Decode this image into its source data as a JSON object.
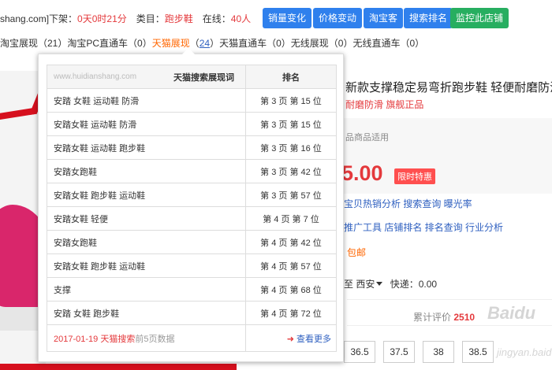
{
  "topbar": {
    "shop_domain": "shang.com",
    "downframe_label": "]下架：",
    "downframe_value": "0天0时21分",
    "category_label": "类目：",
    "category_value": "跑步鞋",
    "online_label": "在线：",
    "online_value": "40人",
    "buttons": [
      "销量变化",
      "价格变动",
      "淘宝客",
      "搜索排名",
      "监控此店铺"
    ]
  },
  "subbar": {
    "text1": "淘宝展现（21）淘宝PC直通车（0）",
    "tmall_show": "天猫展现",
    "tmall_count": "24",
    "text2": "天猫直通车（0）无线展现（0）无线直通车（0）"
  },
  "popup": {
    "watermark": "www.huidianshang.com",
    "col_keyword": "天猫搜索展现词",
    "col_rank": "排名",
    "rows": [
      {
        "keyword": "安踏 女鞋 运动鞋 防滑",
        "rank": "第 3 页 第 15 位"
      },
      {
        "keyword": "安踏女鞋 运动鞋 防滑",
        "rank": "第 3 页 第 15 位"
      },
      {
        "keyword": "安踏女鞋 运动鞋 跑步鞋",
        "rank": "第 3 页 第 16 位"
      },
      {
        "keyword": "安踏女跑鞋",
        "rank": "第 3 页 第 42 位"
      },
      {
        "keyword": "安踏女鞋 跑步鞋 运动鞋",
        "rank": "第 3 页 第 57 位"
      },
      {
        "keyword": "安踏女鞋 轻便",
        "rank": "第 4 页 第 7 位"
      },
      {
        "keyword": "安踏女跑鞋",
        "rank": "第 4 页 第 42 位"
      },
      {
        "keyword": "安踏女鞋 跑步鞋 运动鞋",
        "rank": "第 4 页 第 57 位"
      },
      {
        "keyword": "支撑",
        "rank": "第 4 页 第 68 位"
      },
      {
        "keyword": "安踏 女鞋 跑步鞋",
        "rank": "第 4 页 第 72 位"
      }
    ],
    "footer_date": "2017-01-19 天猫搜索",
    "footer_note": "前5页数据",
    "more_label": "查看更多"
  },
  "product": {
    "title": "新款支撑稳定易弯折跑步鞋 轻便耐磨防滑",
    "tags": "耐磨防滑 旗舰正品",
    "price_note": "品商品适用",
    "price": "5.00",
    "promo": "限时特惠",
    "links1": "宝贝热销分析 搜索查询 曝光率",
    "links2": "推广工具 店铺排名 排名查询 行业分析",
    "shipping_tag": "包邮",
    "ship_prefix": "至",
    "ship_city": "西安",
    "ship_fee": "快递：0.00",
    "review_label": "累计评价",
    "review_count": "2510",
    "sizes": [
      "36.5",
      "37.5",
      "38",
      "38.5"
    ],
    "watermark1": "Baidu",
    "watermark2": "jingyan.baidu"
  }
}
